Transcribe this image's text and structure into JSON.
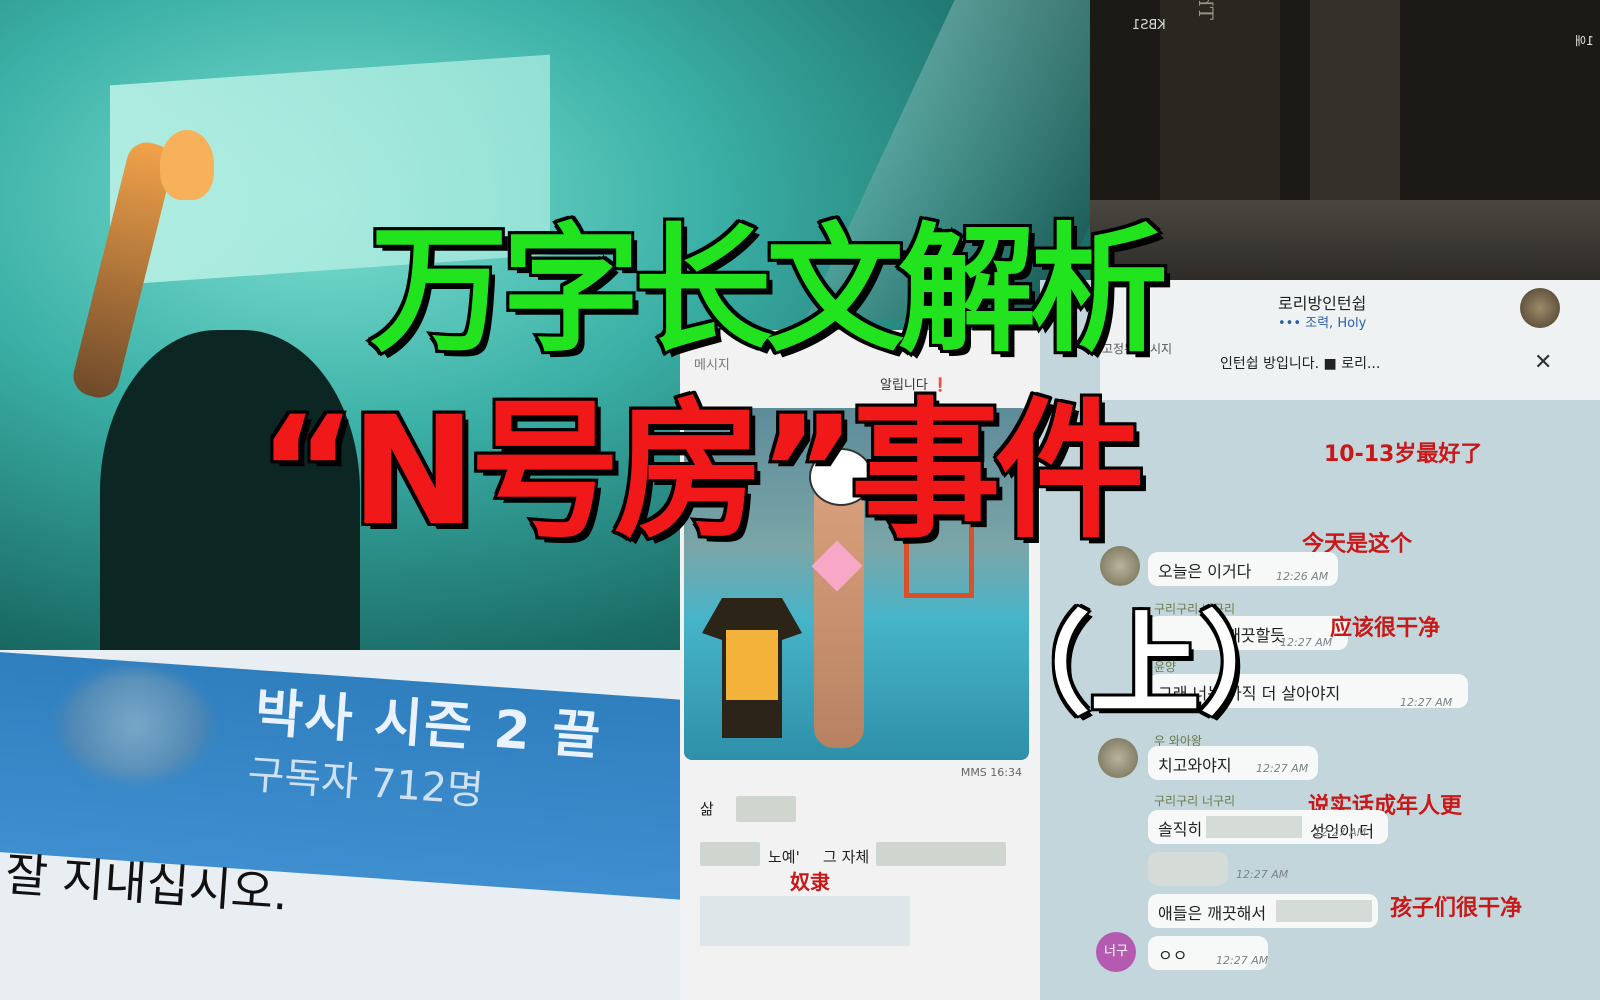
{
  "title": {
    "line1": "万字长文解析",
    "line2": "“N号房”事件",
    "line3": "（上）"
  },
  "book_photo": {
    "tv_logo": "KBS1",
    "spine_text": "The Hotel Book",
    "corner": "1애"
  },
  "blue_screen": {
    "line1": "박사 시즌 2 끌",
    "line2": "구독자 712명",
    "line3": "잘 지내십시오."
  },
  "chat_mid": {
    "header": "메시지",
    "notice_fragment": "알립니다 ❗",
    "mms_time": "MMS 16:34",
    "word_sal": "삶",
    "word_noye": "노예'",
    "word_geu_jache": "그 자체",
    "caption_slave": "奴隶"
  },
  "chat_right": {
    "room_name": "로리방인턴쉽",
    "room_sub": "••• 조력, Holy",
    "notice_label": "고정된 메시지",
    "notice_text": "인턴쉽 방입니다. ■ 로리...",
    "close": "✕",
    "messages": [
      {
        "caption": "10-13岁最好了"
      },
      {
        "caption": "今天是这个",
        "text": "오늘은 이거다",
        "time": "12:26 AM"
      },
      {
        "sender": "구리구리 너구리",
        "text": "깨끗할듯",
        "caption": "应该很干净",
        "time": "12:27 AM"
      },
      {
        "sender": "윤양",
        "text": "그래 너는 아직 더 살아야지",
        "time": "12:27 AM"
      },
      {
        "sender": "우 와아왕",
        "text": "치고와야지",
        "time": "12:27 AM"
      },
      {
        "sender": "구리구리 너구리",
        "text": "솔직히",
        "text2": "성인이 더",
        "caption": "说实话成年人更",
        "time": "12:27 AM"
      },
      {
        "time": "12:27 AM"
      },
      {
        "text": "애들은 깨끗해서",
        "caption": "孩子们很干净"
      },
      {
        "avatar": "너구",
        "text": "ㅇㅇ",
        "time": "12:27 AM"
      }
    ]
  }
}
